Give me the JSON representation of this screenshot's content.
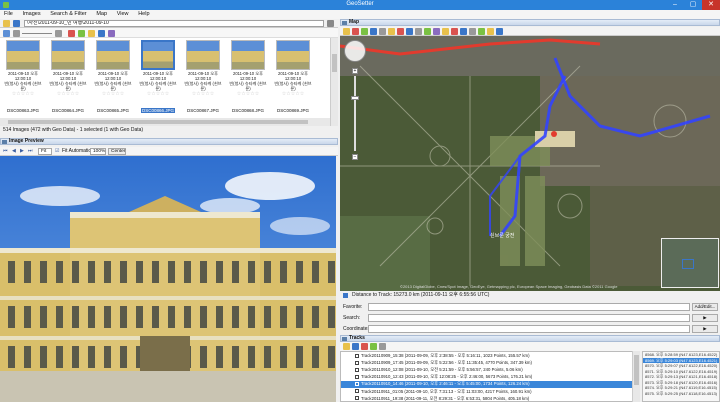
{
  "window": {
    "title": "GeoSetter"
  },
  "menu": [
    "File",
    "Images",
    "Search & Filter",
    "Map",
    "View",
    "Help"
  ],
  "toolbar": {
    "path": "\\사진\\2011-09-10_빈 여행\\2011-09-10"
  },
  "thumbnails": [
    {
      "caption": "2011-09-10 오후 12:00:10\n빈(청사) 슈타케 (쇤브룬)",
      "file": "DSC00863.JPG",
      "selected": false
    },
    {
      "caption": "2011-09-10 오후 12:00:10\n빈(청사) 슈타케 (쇤브룬)",
      "file": "DSC00864.JPG",
      "selected": false
    },
    {
      "caption": "2011-09-10 오후 12:00:10\n빈(청사) 슈타케 (쇤브룬)",
      "file": "DSC00865.JPG",
      "selected": false
    },
    {
      "caption": "2011-09-10 오후 12:00:10\n빈(청사) 슈타케 (쇤브룬)",
      "file": "DSC00866.JPG",
      "selected": true
    },
    {
      "caption": "2011-09-10 오후 12:00:10\n빈(청사) 슈타케 (쇤브룬)",
      "file": "DSC00867.JPG",
      "selected": false
    },
    {
      "caption": "2011-09-10 오후 12:00:10\n빈(청사) 슈타케 (쇤브룬)",
      "file": "DSC00868.JPG",
      "selected": false
    },
    {
      "caption": "2011-09-10 오후 12:00:10\n빈(청사) 슈타케 (쇤브룬)",
      "file": "DSC00869.JPG",
      "selected": false
    }
  ],
  "thumb_stars": "☆☆☆☆☆",
  "status": {
    "images": "514 Images (472 with Geo Data) - 1 selected (1 with Geo Data)"
  },
  "preview": {
    "title": "Image Preview",
    "fit_label": "Fit",
    "fit_auto": "Fit Automatically",
    "zoom": "100%",
    "center": "Center"
  },
  "map": {
    "panel_title": "Map",
    "attribution": "©2013 DigitalGlobe, Cnes/Spot Image, GeoEye, Getmapping plc, European Space Imaging, Geobasis Data ©2011 Google",
    "label_park": "쇤브룬 궁전"
  },
  "distance": "Distance to Track: 15273.0 km (2011-09-11 오후 6:55:56 UTC)",
  "fields": {
    "favorite_label": "Favorite:",
    "search_label": "Search:",
    "coordinates_label": "Coordinates:",
    "add_edit": "Add/Edit..."
  },
  "tracks": {
    "title": "Tracks",
    "rows": [
      {
        "text": "Track20110909_15:38 (2011-09-09, 오후 2:38:55 - 오후 5:16:11, 1023 Points, 155.57 km)",
        "selected": false
      },
      {
        "text": "Track20110909_17:45 (2011-09-09, 오후 5:22:56 - 오후 11:35:45, 4770 Points, 347.39 km)",
        "selected": false
      },
      {
        "text": "Track20110910_12:08 (2011-09-10, 오전 5:21:59 - 오후 5:56:57, 240 Points, 5.06 km)",
        "selected": false
      },
      {
        "text": "Track20110910_12:43 (2011-09-10, 오후 12:08:25 - 오후 2:46:00, 5673 Points, 176.21 km)",
        "selected": false
      },
      {
        "text": "Track20110910_14:46 (2011-09-10, 오후 2:46:11 - 오후 5:45:00, 1734 Points, 126.24 km)",
        "selected": true
      },
      {
        "text": "Track20110911_01:05 (2011-09-10, 오후 7:31:13 - 오후 11:03:00, 4217 Points, 160.91 km)",
        "selected": false
      },
      {
        "text": "Track20110911_19:38 (2011-09-11, 오전 8:29:31 - 오후 6:53:31, 5804 Points, 405.18 km)",
        "selected": false
      }
    ]
  },
  "tracks_right": [
    {
      "text": "8568. 오후 5:28:59 (N47.6123,E16.4522)",
      "selected": false
    },
    {
      "text": "8569. 오후 5:29:03 (N47.6123,E16.4521)",
      "selected": true
    },
    {
      "text": "8570. 오후 5:29:07 (N47.6122,E16.4520)",
      "selected": false
    },
    {
      "text": "8571. 오후 5:29:10 (N47.6122,E16.4519)",
      "selected": false
    },
    {
      "text": "8572. 오후 5:29:13 (N47.6121,E16.4518)",
      "selected": false
    },
    {
      "text": "8573. 오후 5:29:18 (N47.6120,E16.4516)",
      "selected": false
    },
    {
      "text": "8574. 오후 5:29:21 (N47.6119,E16.4515)",
      "selected": false
    },
    {
      "text": "8575. 오후 5:29:25 (N47.6118,E16.4513)",
      "selected": false
    }
  ],
  "colors": {
    "accent": "#2b82d9",
    "track": "#3344ff",
    "route": "#e23b2e"
  }
}
